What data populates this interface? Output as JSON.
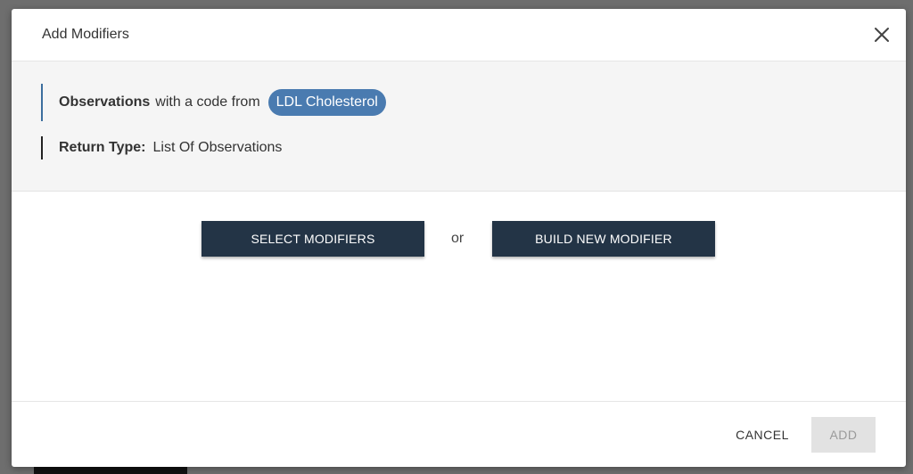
{
  "modal": {
    "title": "Add Modifiers",
    "close_icon": "close-icon"
  },
  "summary": {
    "resource": "Observations",
    "connector": "with a code from",
    "code_pill": "LDL Cholesterol",
    "return_type_label": "Return Type:",
    "return_type_value": "List Of Observations"
  },
  "actions": {
    "select_label": "SELECT MODIFIERS",
    "or_label": "or",
    "build_label": "BUILD NEW MODIFIER"
  },
  "footer": {
    "cancel_label": "CANCEL",
    "add_label": "ADD",
    "add_disabled": true
  },
  "colors": {
    "pill_bg": "#4a7bb0",
    "dark_button": "#233446",
    "summary_bg": "#f5f5f5"
  }
}
